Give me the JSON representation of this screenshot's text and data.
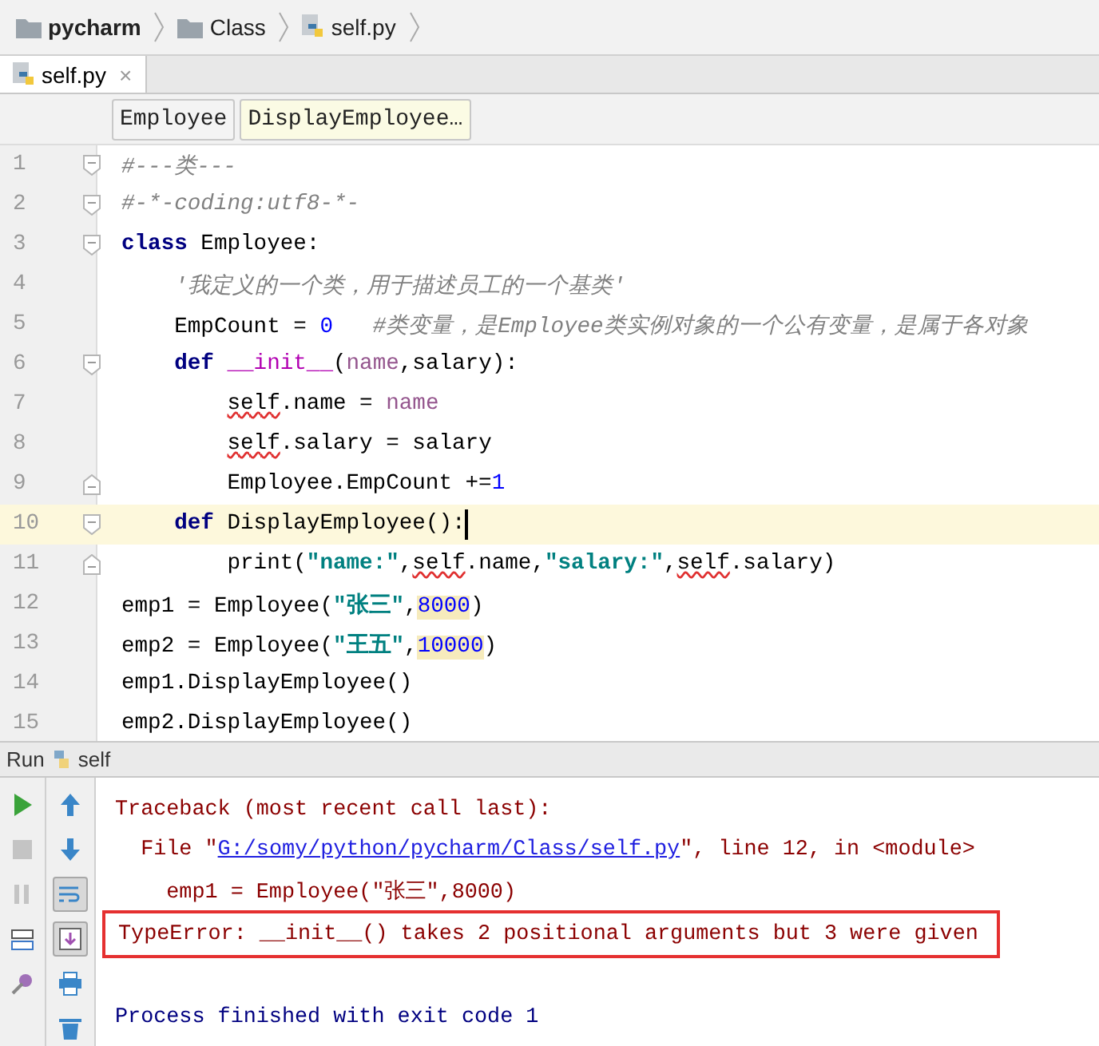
{
  "breadcrumbs": [
    {
      "kind": "folder",
      "label": "pycharm",
      "bold": true
    },
    {
      "kind": "folder",
      "label": "Class",
      "bold": false
    },
    {
      "kind": "python",
      "label": "self.py",
      "bold": false
    }
  ],
  "tabs": [
    {
      "label": "self.py",
      "close": "×",
      "selected": true
    }
  ],
  "structure_crumbs": [
    {
      "label": "Employee",
      "selected": false
    },
    {
      "label": "DisplayEmployee…",
      "selected": true
    }
  ],
  "editor": {
    "lines": [
      {
        "number": "1",
        "kind": "fold-start",
        "current": false,
        "tokens": [
          {
            "kind": "comment",
            "text": "#---类---"
          }
        ]
      },
      {
        "number": "2",
        "kind": "fold-start",
        "current": false,
        "tokens": [
          {
            "kind": "comment",
            "text": "#-*-coding:utf8-*-"
          }
        ]
      },
      {
        "number": "3",
        "kind": "fold-start",
        "current": false,
        "tokens": [
          {
            "kind": "keyword",
            "text": "class"
          },
          {
            "kind": "plain",
            "text": " Employee:"
          }
        ]
      },
      {
        "number": "4",
        "kind": "plain",
        "current": false,
        "tokens": [
          {
            "kind": "comment",
            "text": "    '我定义的一个类，用于描述员工的一个基类'"
          }
        ]
      },
      {
        "number": "5",
        "kind": "plain",
        "current": false,
        "tokens": [
          {
            "kind": "plain",
            "text": "    EmpCount = "
          },
          {
            "kind": "number",
            "text": "0"
          },
          {
            "kind": "comment",
            "text": "   #类变量，是Employee类实例对象的一个公有变量，是属于各对象"
          }
        ]
      },
      {
        "number": "6",
        "kind": "fold-start",
        "current": false,
        "tokens": [
          {
            "kind": "keyword",
            "text": "    def"
          },
          {
            "kind": "magic",
            "text": " __init__"
          },
          {
            "kind": "plain",
            "text": "("
          },
          {
            "kind": "param",
            "text": "name"
          },
          {
            "kind": "plain",
            "text": ",salary):"
          }
        ]
      },
      {
        "number": "7",
        "kind": "plain",
        "current": false,
        "tokens": [
          {
            "kind": "self",
            "text": "        self"
          },
          {
            "kind": "plain",
            "text": ".name = "
          },
          {
            "kind": "param",
            "text": "name"
          }
        ]
      },
      {
        "number": "8",
        "kind": "plain",
        "current": false,
        "tokens": [
          {
            "kind": "self",
            "text": "        self"
          },
          {
            "kind": "plain",
            "text": ".salary = salary"
          }
        ]
      },
      {
        "number": "9",
        "kind": "fold-end",
        "current": false,
        "tokens": [
          {
            "kind": "plain",
            "text": "        Employee.EmpCount +="
          },
          {
            "kind": "number",
            "text": "1"
          }
        ]
      },
      {
        "number": "10",
        "kind": "fold-start",
        "current": true,
        "tokens": [
          {
            "kind": "keyword",
            "text": "    def"
          },
          {
            "kind": "plain",
            "text": " DisplayEmployee():"
          }
        ]
      },
      {
        "number": "11",
        "kind": "fold-end",
        "current": false,
        "tokens": [
          {
            "kind": "plain",
            "text": "        print("
          },
          {
            "kind": "string",
            "text": "\"name:\""
          },
          {
            "kind": "plain",
            "text": ","
          },
          {
            "kind": "self",
            "text": "self"
          },
          {
            "kind": "plain",
            "text": ".name,"
          },
          {
            "kind": "string",
            "text": "\"salary:\""
          },
          {
            "kind": "plain",
            "text": ","
          },
          {
            "kind": "self",
            "text": "self"
          },
          {
            "kind": "plain",
            "text": ".salary)"
          }
        ]
      },
      {
        "number": "12",
        "kind": "plain",
        "current": false,
        "tokens": [
          {
            "kind": "plain",
            "text": "emp1 = Employee("
          },
          {
            "kind": "string",
            "text": "\"张三\""
          },
          {
            "kind": "plain",
            "text": ","
          },
          {
            "kind": "flagged-number",
            "text": "8000"
          },
          {
            "kind": "plain",
            "text": ")"
          }
        ]
      },
      {
        "number": "13",
        "kind": "plain",
        "current": false,
        "tokens": [
          {
            "kind": "plain",
            "text": "emp2 = Employee("
          },
          {
            "kind": "string",
            "text": "\"王五\""
          },
          {
            "kind": "plain",
            "text": ","
          },
          {
            "kind": "flagged-number",
            "text": "10000"
          },
          {
            "kind": "plain",
            "text": ")"
          }
        ]
      },
      {
        "number": "14",
        "kind": "plain",
        "current": false,
        "tokens": [
          {
            "kind": "plain",
            "text": "emp1.DisplayEmployee()"
          }
        ]
      },
      {
        "number": "15",
        "kind": "plain",
        "current": false,
        "tokens": [
          {
            "kind": "plain",
            "text": "emp2.DisplayEmployee()"
          }
        ]
      }
    ]
  },
  "run_panel": {
    "title": "Run",
    "config": "self",
    "left_tools": [
      {
        "kind": "run",
        "on": false
      },
      {
        "kind": "stop",
        "on": false
      },
      {
        "kind": "pause",
        "on": false
      },
      {
        "kind": "layout",
        "on": false
      },
      {
        "kind": "pin",
        "on": false
      }
    ],
    "right_tools": [
      {
        "kind": "up",
        "on": false
      },
      {
        "kind": "down",
        "on": false
      },
      {
        "kind": "wrap",
        "on": true
      },
      {
        "kind": "scroll",
        "on": true
      },
      {
        "kind": "print",
        "on": false
      },
      {
        "kind": "trash",
        "on": false
      }
    ],
    "console": [
      {
        "kind": "error",
        "boxed": false,
        "tokens": [
          {
            "kind": "text",
            "text": "Traceback (most recent call last):"
          }
        ]
      },
      {
        "kind": "error",
        "boxed": false,
        "tokens": [
          {
            "kind": "text",
            "text": "  File \""
          },
          {
            "kind": "link",
            "text": "G:/somy/python/pycharm/Class/self.py"
          },
          {
            "kind": "text",
            "text": "\", line 12, in <module>"
          }
        ]
      },
      {
        "kind": "error",
        "boxed": false,
        "tokens": [
          {
            "kind": "text",
            "text": "    emp1 = Employee(\"张三\",8000)"
          }
        ]
      },
      {
        "kind": "error",
        "boxed": true,
        "tokens": [
          {
            "kind": "text",
            "text": "TypeError: __init__() takes 2 positional arguments but 3 were given"
          }
        ]
      },
      {
        "kind": "blank",
        "boxed": false
      },
      {
        "kind": "info",
        "boxed": false,
        "tokens": [
          {
            "kind": "text",
            "text": "Process finished with exit code 1"
          }
        ]
      }
    ]
  }
}
